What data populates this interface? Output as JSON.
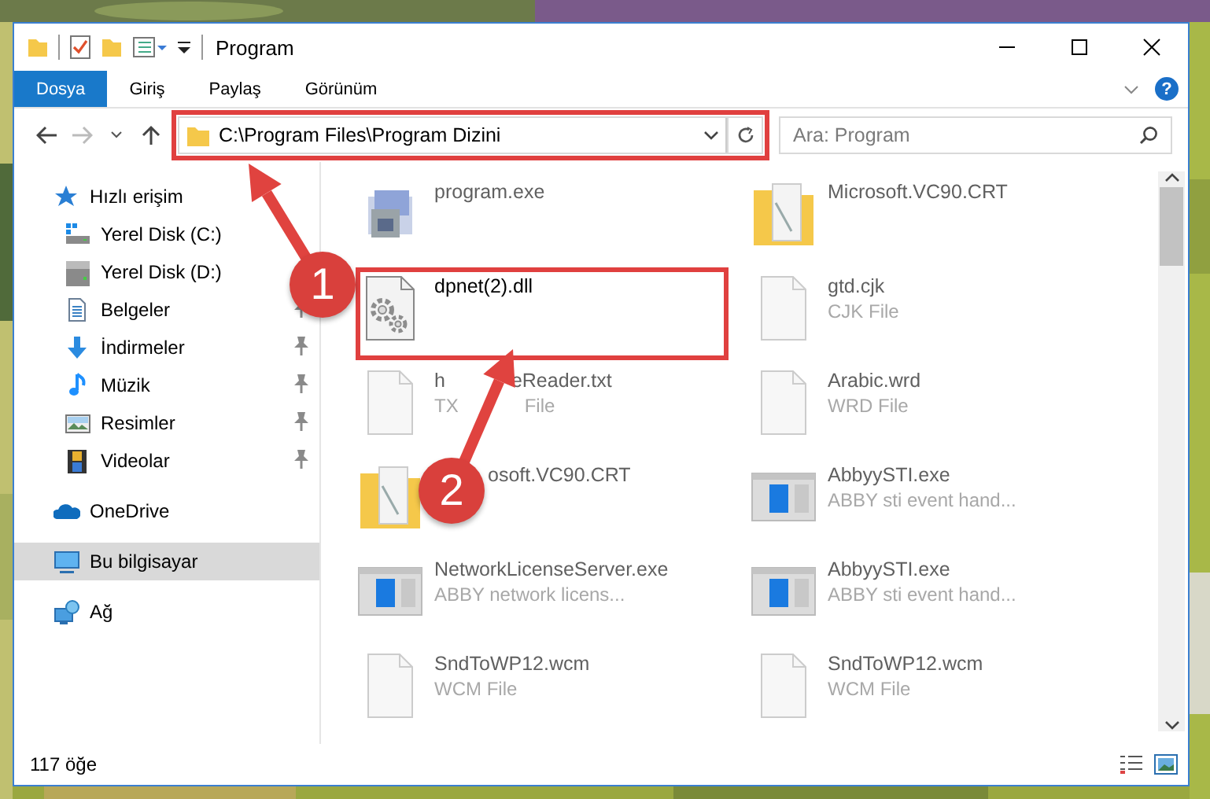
{
  "window": {
    "title": "Program"
  },
  "ribbon_tabs": [
    {
      "label": "Dosya",
      "selected": true
    },
    {
      "label": "Giriş",
      "selected": false
    },
    {
      "label": "Paylaş",
      "selected": false
    },
    {
      "label": "Görünüm",
      "selected": false
    }
  ],
  "help": "?",
  "address": {
    "path": "C:\\Program Files\\Program Dizini"
  },
  "search": {
    "placeholder": "Ara: Program"
  },
  "sidebar": {
    "items": [
      {
        "label": "Hızlı erişim",
        "kind": "star",
        "selected": false,
        "children": [
          {
            "label": "Yerel Disk (C:)",
            "kind": "drive-windows",
            "selected": false,
            "pinned": false
          },
          {
            "label": "Yerel Disk (D:)",
            "kind": "drive",
            "selected": false,
            "pinned": false
          },
          {
            "label": "Belgeler",
            "kind": "documents",
            "selected": false,
            "pinned": true
          },
          {
            "label": "İndirmeler",
            "kind": "download",
            "selected": false,
            "pinned": true
          },
          {
            "label": "Müzik",
            "kind": "music",
            "selected": false,
            "pinned": true
          },
          {
            "label": "Resimler",
            "kind": "pictures",
            "selected": false,
            "pinned": true
          },
          {
            "label": "Videolar",
            "kind": "video",
            "selected": false,
            "pinned": true
          }
        ]
      },
      {
        "label": "OneDrive",
        "kind": "cloud",
        "selected": false
      },
      {
        "label": "Bu bilgisayar",
        "kind": "computer",
        "selected": true
      },
      {
        "label": "Ağ",
        "kind": "network",
        "selected": false
      }
    ]
  },
  "files": [
    {
      "name": "program.exe",
      "kind": "app",
      "dimmed": true
    },
    {
      "name": "Microsoft.VC90.CRT",
      "kind": "folder",
      "dimmed": true
    },
    {
      "name": "dpnet(2).dll",
      "kind": "dll",
      "dimmed": false
    },
    {
      "name": "gtd.cjk",
      "type": "CJK File",
      "kind": "file",
      "dimmed": true
    },
    {
      "name_parts": [
        "h",
        "eReader.txt"
      ],
      "type_parts": [
        "TX",
        "File"
      ],
      "kind": "file",
      "dimmed": true
    },
    {
      "name": "Arabic.wrd",
      "type": "WRD File",
      "kind": "file",
      "dimmed": true
    },
    {
      "name": "osoft.VC90.CRT",
      "kind": "folder",
      "dimmed": true,
      "covered": true
    },
    {
      "name": "AbbyySTI.exe",
      "type": "ABBY sti event hand...",
      "kind": "window",
      "dimmed": true
    },
    {
      "name": "NetworkLicenseServer.exe",
      "type": "ABBY network licens...",
      "kind": "window",
      "dimmed": true
    },
    {
      "name": "AbbyySTI.exe",
      "type": "ABBY sti event hand...",
      "kind": "window",
      "dimmed": true
    },
    {
      "name": "SndToWP12.wcm",
      "type": "WCM File",
      "kind": "file",
      "dimmed": true
    },
    {
      "name": "SndToWP12.wcm",
      "type": "WCM File",
      "kind": "file",
      "dimmed": true
    }
  ],
  "status_bar": {
    "count": "117 öğe"
  },
  "annotations": [
    {
      "number": "1"
    },
    {
      "number": "2"
    }
  ]
}
